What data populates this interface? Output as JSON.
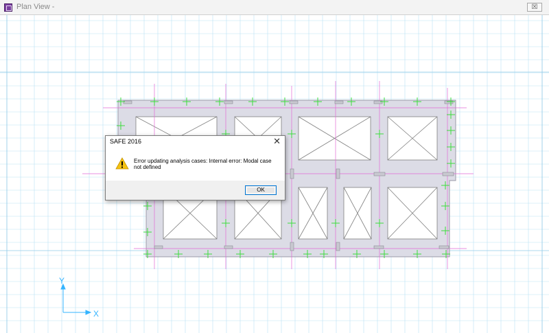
{
  "window": {
    "title": "Plan View - ",
    "close_label": "☒"
  },
  "axes": {
    "x_label": "X",
    "y_label": "Y"
  },
  "dialog": {
    "title": "SAFE 2016",
    "close_glyph": "✕",
    "message": "Error updating analysis cases: Internal error: Modal case not defined",
    "ok_label": "OK",
    "icon": "warning-icon"
  },
  "colors": {
    "grid": "#b9e1f5",
    "slab": "#dcdce6",
    "gridline_magenta": "#e36ad6",
    "support_green": "#3cdc3c",
    "axis": "#35b4ff",
    "accent": "#0078d7"
  }
}
